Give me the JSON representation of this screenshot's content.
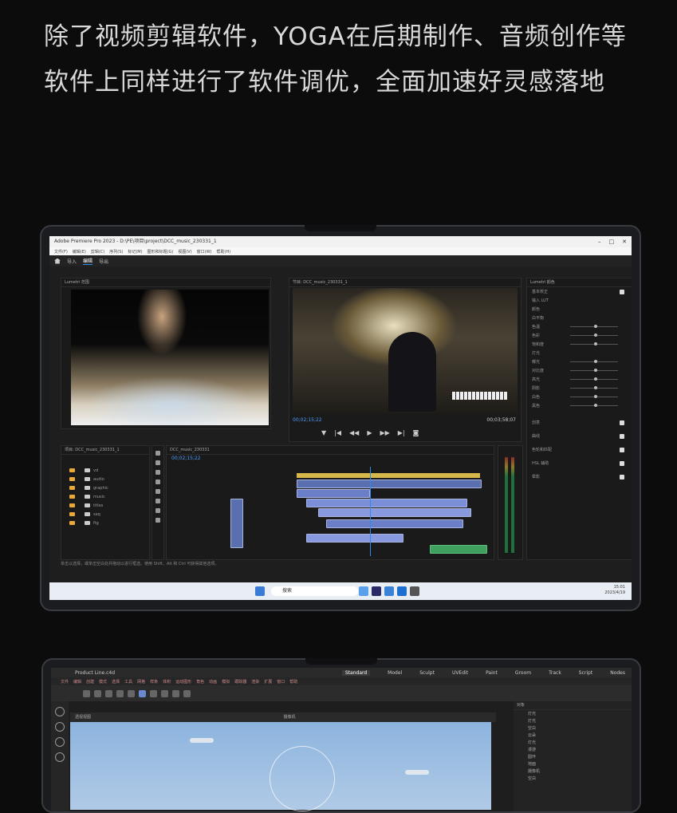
{
  "headline": "除了视频剪辑软件，YOGA在后期制作、音频创作等软件上同样进行了软件调优，全面加速好灵感落地",
  "premiere": {
    "window_title": "Adobe Premiere Pro 2023 - D:\\PE\\项目\\project\\DCC_music_230331_1",
    "workspace_tabs": [
      "导入",
      "编辑",
      "导出"
    ],
    "active_tab": "编辑",
    "source_panel_title": "Lumetri 范围",
    "program_panel_title": "节目: DCC_music_230331_1",
    "program_timecode_in": "00;02;15;22",
    "program_timecode_out": "00;03;58;07",
    "timeline_timecode": "00;02;15;22",
    "lumetri_title": "Lumetri 颜色",
    "lumetri_rows": [
      "基本校正",
      "输入 LUT",
      "颜色",
      "白平衡",
      "色温",
      "色彩",
      "饱和度",
      "灯光",
      "曝光",
      "对比度",
      "高光",
      "阴影",
      "白色",
      "黑色",
      "创意",
      "曲线",
      "色轮和匹配",
      "HSL 辅助",
      "晕影"
    ],
    "project_panel_title": "项目: DCC_music_230331_1",
    "project_folders": [
      "vd",
      "audio",
      "graphic",
      "music",
      "titles",
      "seq",
      "ftg"
    ],
    "status_text": "单击以选择，或单击空白处并拖动以进行框选。使用 Shift、Alt 和 Ctrl 可获得其他选项。",
    "taskbar_search": "搜索",
    "clock_time": "15:01",
    "clock_date": "2023/4/19",
    "accent": "#2d8ceb"
  },
  "cinema4d": {
    "file_tab": "Product Line.c4d",
    "layout_tabs": [
      "Standard",
      "Model",
      "Sculpt",
      "UVEdit",
      "Paint",
      "Groom",
      "Track",
      "Script",
      "Nodes"
    ],
    "active_layout": "Standard",
    "viewport_label": "透视视图",
    "camera_label": "摄像机",
    "objects_header": "对象",
    "object_rows": [
      "灯光",
      "灯光",
      "空白",
      "云朵",
      "灯光",
      "漫游",
      "圆环",
      "地面",
      "摄像机",
      "空白"
    ]
  }
}
